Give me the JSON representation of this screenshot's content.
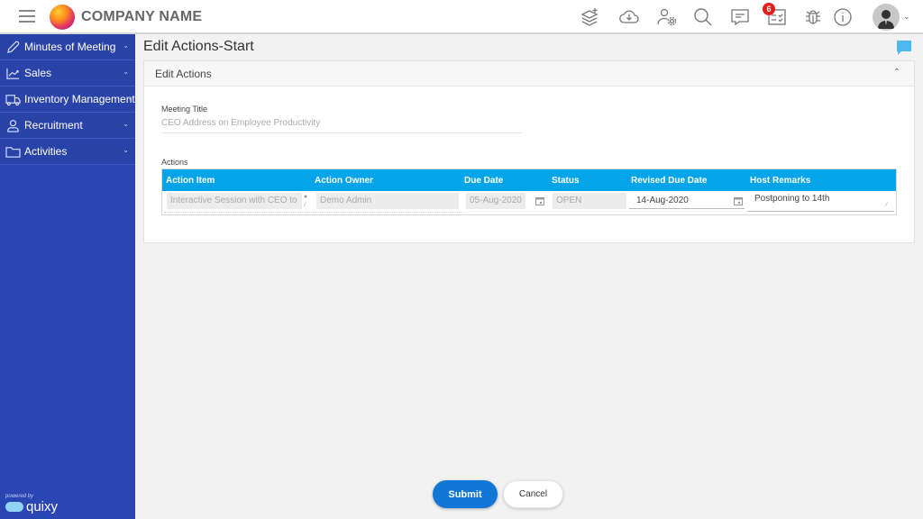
{
  "header": {
    "company_name": "COMPANY NAME",
    "notification_count": "6",
    "icons": [
      "layers-add-icon",
      "cloud-download-icon",
      "user-settings-icon",
      "search-icon",
      "chat-message-icon",
      "tasks-checklist-icon",
      "bug-icon",
      "info-icon"
    ]
  },
  "sidebar": {
    "items": [
      {
        "label": "Minutes of Meeting",
        "icon": "pen-icon"
      },
      {
        "label": "Sales",
        "icon": "line-chart-icon"
      },
      {
        "label": "Inventory Management",
        "icon": "truck-icon"
      },
      {
        "label": "Recruitment",
        "icon": "person-icon"
      },
      {
        "label": "Activities",
        "icon": "folder-icon"
      }
    ],
    "powered_by": "powered by",
    "brand": "quixy"
  },
  "page": {
    "title": "Edit Actions-Start",
    "panel_title": "Edit Actions",
    "meeting_title_label": "Meeting Title",
    "meeting_title_value": "CEO Address on Employee Productivity",
    "actions_label": "Actions"
  },
  "actions_table": {
    "columns": [
      "Action Item",
      "Action Owner",
      "Due Date",
      "Status",
      "Revised Due Date",
      "Host Remarks"
    ],
    "rows": [
      {
        "action_item": "Interactive Session with CEO to",
        "action_owner": "Demo Admin",
        "due_date": "05-Aug-2020",
        "status": "OPEN",
        "revised_due_date": "14-Aug-2020",
        "host_remarks": "Postponing to 14th"
      }
    ]
  },
  "buttons": {
    "submit": "Submit",
    "cancel": "Cancel"
  },
  "colors": {
    "sidebar": "#2b46b4",
    "table_header": "#04a5e8",
    "primary_button": "#1177d6",
    "badge": "#e0201b"
  }
}
